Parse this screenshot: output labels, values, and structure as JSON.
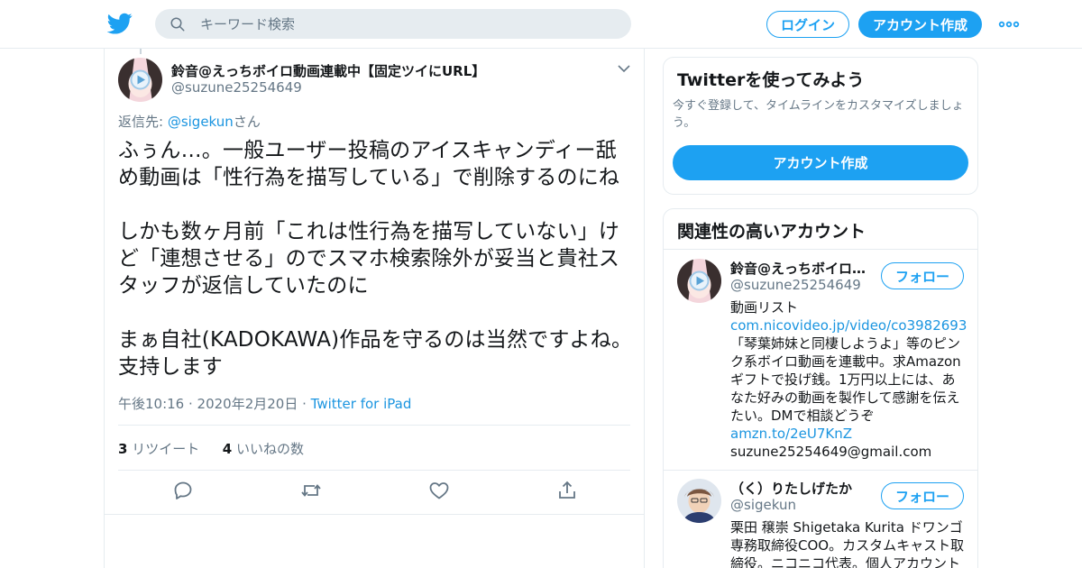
{
  "header": {
    "search_placeholder": "キーワード検索",
    "login_label": "ログイン",
    "signup_label": "アカウント作成",
    "icons": [
      "twitter-bird-icon",
      "search-icon",
      "more-icon"
    ],
    "brand_color": "#1da1f2"
  },
  "tweet": {
    "author_name": "鈴音@えっちボイロ動画連載中【固定ツイにURL】",
    "author_handle": "@suzune25254649",
    "reply_prefix": "返信先: ",
    "reply_mention": "@sigekun",
    "reply_suffix": "さん",
    "text": "ふぅん…。一般ユーザー投稿のアイスキャンディー舐め動画は「性行為を描写している」で削除するのにね\n\nしかも数ヶ月前「これは性行為を描写していない」けど「連想させる」のでスマホ検索除外が妥当と貴社スタッフが返信していたのに\n\nまぁ自社(KADOKAWA)作品を守るのは当然ですよね。支持します",
    "timestamp": "午後10:16 · 2020年2月20日",
    "separator": " · ",
    "source": "Twitter for iPad",
    "retweet_count": "3",
    "retweet_label": " リツイート",
    "like_count": "4",
    "like_label": " いいねの数",
    "action_icons": [
      "reply-icon",
      "retweet-icon",
      "like-icon",
      "share-icon"
    ]
  },
  "signup_card": {
    "title": "Twitterを使ってみよう",
    "subtitle": "今すぐ登録して、タイムラインをカスタマイズしましょう。",
    "button_label": "アカウント作成"
  },
  "related": {
    "title": "関連性の高いアカウント",
    "follow_label": "フォロー",
    "accounts": [
      {
        "name": "鈴音@えっちボイロ動画連載中【固定ツイにURL】",
        "handle": "@suzune25254649",
        "bio_1": "動画リスト",
        "bio_link_1": "com.nicovideo.jp/video/co3982693",
        "bio_2": "「琴葉姉妹と同棲しようよ」等のピンク系ボイロ動画を連載中。求Amazonギフトで投げ銭。1万円以上には、あなた好みの動画を製作して感謝を伝えたい。DMで相談どうぞ",
        "bio_link_2": "amzn.to/2eU7KnZ",
        "bio_3": "suzune25254649@gmail.com"
      },
      {
        "name": "（く）りたしげたか",
        "handle": "@sigekun",
        "bio_1": "栗田 穣崇 Shigetaka Kurita ドワンゴ専務取締役COO。カスタムキャスト取締役。ニコニコ代表。個人アカウント"
      }
    ]
  }
}
